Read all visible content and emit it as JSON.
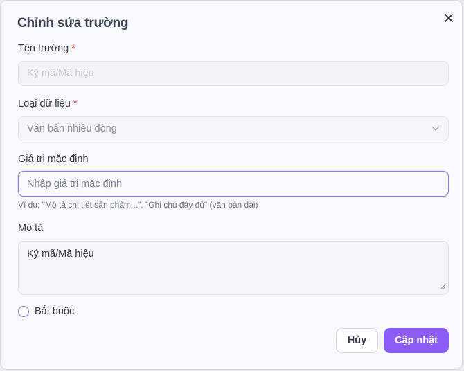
{
  "dialog": {
    "title": "Chỉnh sửa trường",
    "close_icon": "close-icon"
  },
  "fields": {
    "field_name": {
      "label": "Tên trường",
      "required_mark": "*",
      "placeholder": "Ký mã/Mã hiệu"
    },
    "data_type": {
      "label": "Loại dữ liệu",
      "required_mark": "*",
      "value": "Văn bản nhiều dòng",
      "icon": "chevron-down-icon"
    },
    "default_value": {
      "label": "Giá trị mặc định",
      "placeholder": "Nhập giá trị mặc định",
      "hint": "Ví dụ: \"Mô tả chi tiết sản phẩm...\", \"Ghi chú đầy đủ\" (văn bản dài)"
    },
    "description": {
      "label": "Mô tả",
      "value": "Ký mã/Mã hiệu"
    },
    "required": {
      "label": "Bắt buộc"
    }
  },
  "buttons": {
    "cancel": "Hủy",
    "submit": "Cập nhật"
  },
  "colors": {
    "accent": "#8b5cf6",
    "focus_border": "#8b7cf6",
    "required_star": "#e5484d"
  }
}
